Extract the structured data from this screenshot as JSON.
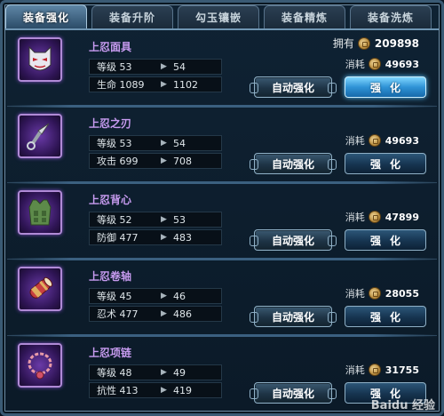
{
  "tabs": [
    {
      "label": "装备强化",
      "active": true
    },
    {
      "label": "装备升阶",
      "active": false
    },
    {
      "label": "勾玉镶嵌",
      "active": false
    },
    {
      "label": "装备精炼",
      "active": false
    },
    {
      "label": "装备洗炼",
      "active": false
    }
  ],
  "owned": {
    "label": "拥有",
    "value": "209898"
  },
  "buttons": {
    "auto_label": "自动强化",
    "strengthen_label": "强化"
  },
  "cost_label": "消耗",
  "items": [
    {
      "name": "上忍面具",
      "icon": "mask-icon",
      "stats": [
        {
          "label": "等级 53",
          "next": "54"
        },
        {
          "label": "生命 1089",
          "next": "1102"
        }
      ],
      "cost": "49693",
      "highlighted": true
    },
    {
      "name": "上忍之刃",
      "icon": "kunai-icon",
      "stats": [
        {
          "label": "等级 53",
          "next": "54"
        },
        {
          "label": "攻击 699",
          "next": "708"
        }
      ],
      "cost": "49693",
      "highlighted": false
    },
    {
      "name": "上忍背心",
      "icon": "vest-icon",
      "stats": [
        {
          "label": "等级 52",
          "next": "53"
        },
        {
          "label": "防御 477",
          "next": "483"
        }
      ],
      "cost": "47899",
      "highlighted": false
    },
    {
      "name": "上忍卷轴",
      "icon": "scroll-icon",
      "stats": [
        {
          "label": "等级 45",
          "next": "46"
        },
        {
          "label": "忍术 477",
          "next": "486"
        }
      ],
      "cost": "28055",
      "highlighted": false
    },
    {
      "name": "上忍项链",
      "icon": "necklace-icon",
      "stats": [
        {
          "label": "等级 48",
          "next": "49"
        },
        {
          "label": "抗性 413",
          "next": "419"
        }
      ],
      "cost": "31755",
      "highlighted": false
    }
  ],
  "colors": {
    "accent": "#2f93d6",
    "item_name": "#c79bf0",
    "frame": "#3a5a74"
  },
  "watermark": "Baidu 经验"
}
